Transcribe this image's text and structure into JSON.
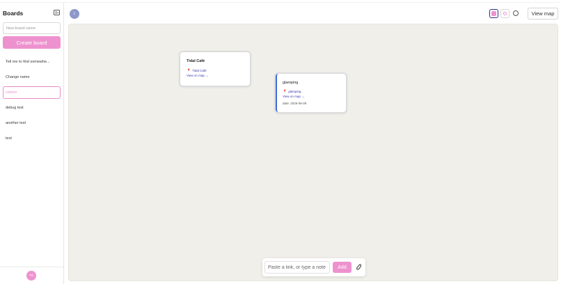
{
  "sidebar": {
    "title": "Boards",
    "new_board_placeholder": "New board name",
    "create_label": "Create board",
    "boards": [
      {
        "label": "Tell me to find somewhe..."
      },
      {
        "label": "Change name"
      },
      {
        "label": "comox",
        "active": true
      },
      {
        "label": "debug test"
      },
      {
        "label": "another test"
      },
      {
        "label": "test"
      }
    ],
    "user_initials": "TO"
  },
  "header": {
    "avatar_initial": "L",
    "view_map_label": "View map"
  },
  "canvas": {
    "cards": [
      {
        "title": "Tidal Café",
        "place": "Tidal Café",
        "link": "View on map →"
      },
      {
        "title": "glamping",
        "place": "glamping",
        "link": "View on map →",
        "date": "date: 2026-06-09"
      }
    ]
  },
  "add_bar": {
    "placeholder": "Paste a link, or type a note",
    "add_label": "Add"
  },
  "colors": {
    "accent_pink": "#ee92cf",
    "canvas_bg": "#f0efea",
    "link_blue": "#3a3ab0",
    "card_accent_blue": "#3f6ad8"
  },
  "icons": [
    "sidebar-collapse-icon",
    "grid-view-icon",
    "list-view-icon",
    "chat-icon",
    "map-pin-icon",
    "paperclip-icon"
  ]
}
